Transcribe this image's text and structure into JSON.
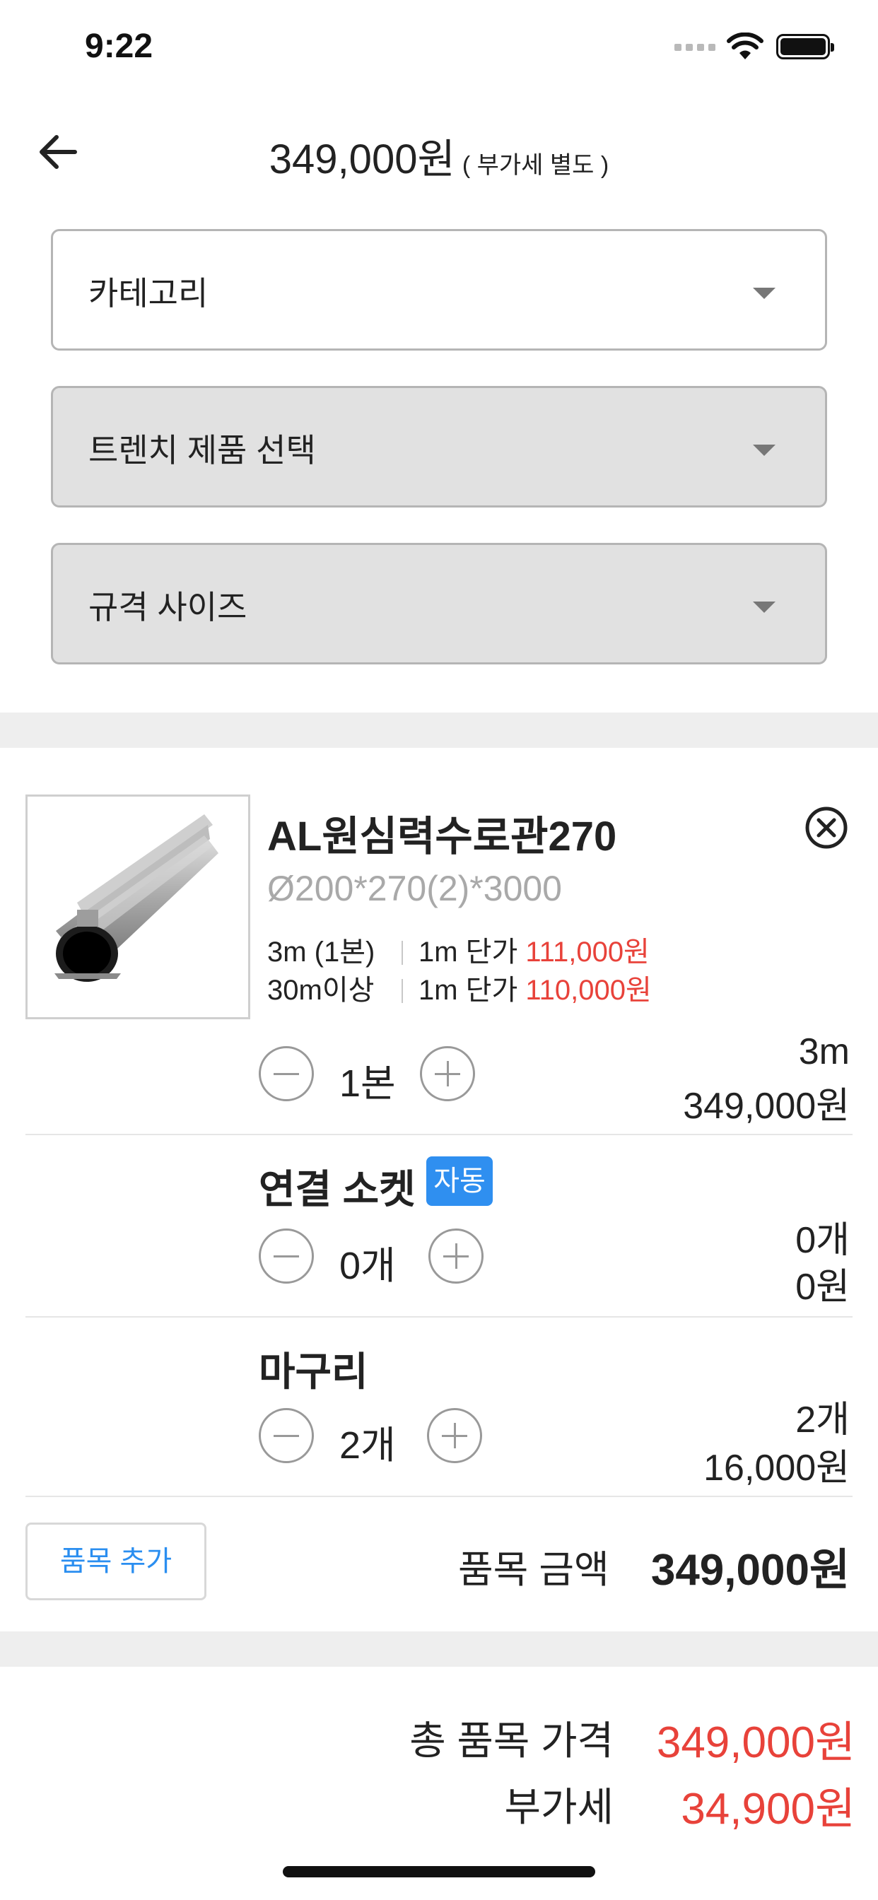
{
  "status_bar": {
    "time": "9:22"
  },
  "header": {
    "amount": "349,000원",
    "vat_note": "( 부가세 별도 )"
  },
  "selects": [
    {
      "label": "카테고리"
    },
    {
      "label": "트렌치 제품 선택"
    },
    {
      "label": "규격 사이즈"
    }
  ],
  "product": {
    "name": "AL원심력수로관270",
    "spec": "Ø200*270(2)*3000",
    "price_rows": [
      {
        "qty": "3m (1본)",
        "unit_label": "1m 단가",
        "unit_price": "111,000원"
      },
      {
        "qty": "30m이상",
        "unit_label": "1m 단가",
        "unit_price": "110,000원"
      }
    ],
    "stepper_value": "1본",
    "right_qty": "3m",
    "right_price": "349,000원"
  },
  "socket": {
    "title": "연결 소켓",
    "badge": "자동",
    "stepper_value": "0개",
    "right_qty": "0개",
    "right_price": "0원"
  },
  "cap": {
    "title": "마구리",
    "stepper_value": "2개",
    "right_qty": "2개",
    "right_price": "16,000원"
  },
  "footer": {
    "add_item": "품목 추가",
    "item_amount_label": "품목 금액",
    "item_amount_value": "349,000원"
  },
  "summary": {
    "total_label": "총 품목 가격",
    "total_value": "349,000원",
    "vat_label": "부가세",
    "vat_value": "34,900원"
  },
  "colors": {
    "accent_blue": "#2f8ff0",
    "price_red": "#e8423a"
  }
}
